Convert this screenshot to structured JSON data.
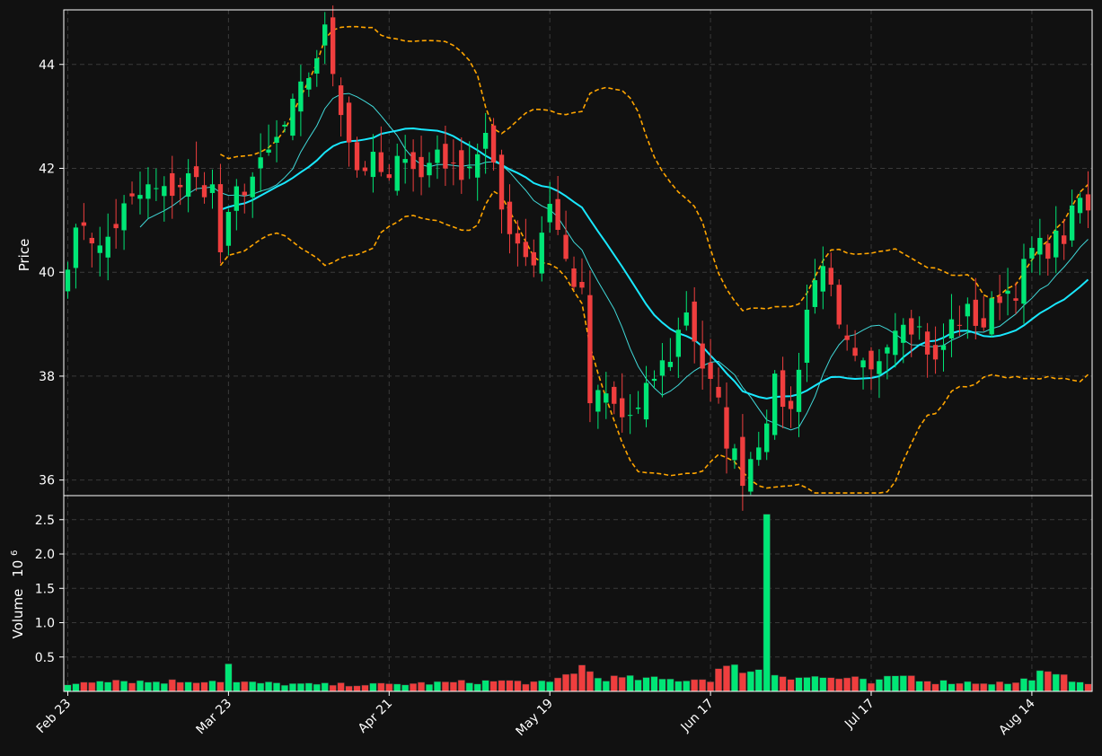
{
  "chart_data": {
    "type": "candlestick",
    "price_panel": {
      "ylabel": "Price",
      "ylim": [
        35.7,
        45.05
      ],
      "yticks": [
        36,
        38,
        40,
        42,
        44
      ]
    },
    "volume_panel": {
      "ylabel": "Volume",
      "exponent": "10",
      "exponent_power": "6",
      "ylim": [
        0,
        2.85
      ],
      "yticks": [
        0.5,
        1.0,
        1.5,
        2.0,
        2.5
      ],
      "ytick_labels": [
        "0.5",
        "1.0",
        "1.5",
        "2.0",
        "2.5"
      ]
    },
    "x_ticks": [
      {
        "index": 0,
        "label": "Feb 23"
      },
      {
        "index": 20,
        "label": "Mar 23"
      },
      {
        "index": 40,
        "label": "Apr 21"
      },
      {
        "index": 60,
        "label": "May 19"
      },
      {
        "index": 80,
        "label": "Jun 17"
      },
      {
        "index": 100,
        "label": "Jul 17"
      },
      {
        "index": 120,
        "label": "Aug 14"
      }
    ],
    "grid": true,
    "colors": {
      "up": "#00e676",
      "down": "#ef3e3e",
      "ma_short": "#40d8d8",
      "ma_long": "#19e8ff",
      "bands": "#ffa500",
      "grid": "#3a3a3a",
      "frame": "#ffffff"
    },
    "price_anchors": [
      [
        0,
        40.3
      ],
      [
        2,
        41.0
      ],
      [
        4,
        40.4
      ],
      [
        7,
        41.2
      ],
      [
        10,
        41.6
      ],
      [
        12,
        41.5
      ],
      [
        15,
        41.8
      ],
      [
        18,
        41.6
      ],
      [
        19,
        40.4
      ],
      [
        21,
        41.5
      ],
      [
        24,
        42.0
      ],
      [
        27,
        42.8
      ],
      [
        30,
        43.8
      ],
      [
        32,
        44.6
      ],
      [
        34,
        43.2
      ],
      [
        36,
        42.0
      ],
      [
        38,
        42.1
      ],
      [
        40,
        41.7
      ],
      [
        42,
        42.4
      ],
      [
        44,
        41.8
      ],
      [
        46,
        42.4
      ],
      [
        48,
        41.9
      ],
      [
        50,
        42.1
      ],
      [
        52,
        42.6
      ],
      [
        54,
        41.2
      ],
      [
        56,
        40.6
      ],
      [
        58,
        40.2
      ],
      [
        60,
        41.4
      ],
      [
        62,
        40.2
      ],
      [
        64,
        39.5
      ],
      [
        65,
        37.5
      ],
      [
        67,
        37.6
      ],
      [
        69,
        37.2
      ],
      [
        71,
        37.3
      ],
      [
        73,
        38.0
      ],
      [
        75,
        38.4
      ],
      [
        77,
        39.3
      ],
      [
        79,
        38.2
      ],
      [
        81,
        37.4
      ],
      [
        82,
        36.8
      ],
      [
        84,
        36.1
      ],
      [
        86,
        36.8
      ],
      [
        88,
        37.8
      ],
      [
        90,
        37.3
      ],
      [
        92,
        39.3
      ],
      [
        94,
        40.3
      ],
      [
        96,
        38.8
      ],
      [
        98,
        38.2
      ],
      [
        100,
        38.0
      ],
      [
        102,
        38.8
      ],
      [
        104,
        39.2
      ],
      [
        106,
        38.9
      ],
      [
        108,
        38.2
      ],
      [
        110,
        39.0
      ],
      [
        112,
        39.2
      ],
      [
        114,
        39.0
      ],
      [
        116,
        39.6
      ],
      [
        118,
        39.7
      ],
      [
        120,
        40.4
      ],
      [
        122,
        40.5
      ],
      [
        124,
        40.7
      ],
      [
        126,
        41.4
      ],
      [
        127,
        41.1
      ]
    ],
    "volume_anchors": [
      [
        0,
        0.1
      ],
      [
        4,
        0.18
      ],
      [
        10,
        0.14
      ],
      [
        19,
        0.16
      ],
      [
        20,
        0.38
      ],
      [
        21,
        0.13
      ],
      [
        30,
        0.1
      ],
      [
        40,
        0.1
      ],
      [
        45,
        0.12
      ],
      [
        54,
        0.15
      ],
      [
        60,
        0.12
      ],
      [
        64,
        0.36
      ],
      [
        66,
        0.2
      ],
      [
        75,
        0.17
      ],
      [
        80,
        0.18
      ],
      [
        81,
        0.32
      ],
      [
        84,
        0.34
      ],
      [
        86,
        0.3
      ],
      [
        90,
        0.22
      ],
      [
        98,
        0.18
      ],
      [
        100,
        0.12
      ],
      [
        104,
        0.24
      ],
      [
        108,
        0.14
      ],
      [
        118,
        0.12
      ],
      [
        121,
        0.26
      ],
      [
        127,
        0.14
      ]
    ],
    "volume_spike": {
      "index": 87,
      "value": 2.58
    }
  }
}
